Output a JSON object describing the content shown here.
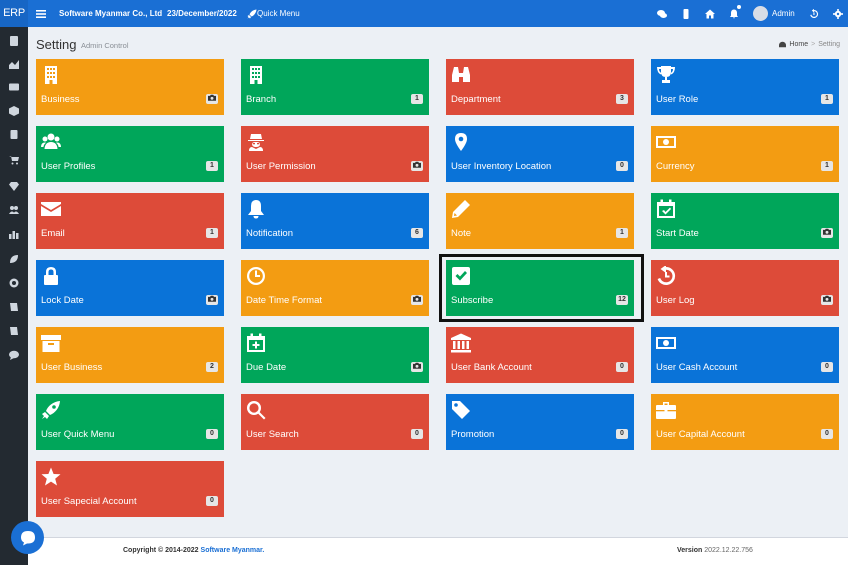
{
  "topbar": {
    "brand": "ERP",
    "company": "Software Myanmar Co., Ltd",
    "date": "23/December/2022",
    "quick_menu": "Quick Menu",
    "user": "Admin"
  },
  "page": {
    "title": "Setting",
    "subtitle": "Admin Control",
    "breadcrumb_home": "Home",
    "breadcrumb_sep": ">",
    "breadcrumb_current": "Setting"
  },
  "tiles": [
    {
      "label": "Business",
      "badge": "",
      "badge_icon": "camera-icon",
      "color": "#f39c12",
      "icon": "building-icon"
    },
    {
      "label": "Branch",
      "badge": "1",
      "color": "#00a65a",
      "icon": "building-icon"
    },
    {
      "label": "Department",
      "badge": "3",
      "color": "#dd4b39",
      "icon": "binoculars-icon"
    },
    {
      "label": "User Role",
      "badge": "1",
      "color": "#0a73d8",
      "icon": "trophy-icon"
    },
    {
      "label": "User Profiles",
      "badge": "1",
      "color": "#00a65a",
      "icon": "users-icon"
    },
    {
      "label": "User Permission",
      "badge": "",
      "badge_icon": "camera-icon",
      "color": "#dd4b39",
      "icon": "user-secret-icon"
    },
    {
      "label": "User Inventory Location",
      "badge": "0",
      "color": "#0a73d8",
      "icon": "map-marker-icon"
    },
    {
      "label": "Currency",
      "badge": "1",
      "color": "#f39c12",
      "icon": "money-icon"
    },
    {
      "label": "Email",
      "badge": "1",
      "color": "#dd4b39",
      "icon": "envelope-icon"
    },
    {
      "label": "Notification",
      "badge": "6",
      "color": "#0a73d8",
      "icon": "bell-icon"
    },
    {
      "label": "Note",
      "badge": "1",
      "color": "#f39c12",
      "icon": "pencil-icon"
    },
    {
      "label": "Start Date",
      "badge": "",
      "badge_icon": "camera-icon",
      "color": "#00a65a",
      "icon": "calendar-check-icon"
    },
    {
      "label": "Lock Date",
      "badge": "",
      "badge_icon": "camera-icon",
      "color": "#0a73d8",
      "icon": "lock-icon"
    },
    {
      "label": "Date Time Format",
      "badge": "",
      "badge_icon": "camera-icon",
      "color": "#f39c12",
      "icon": "clock-icon"
    },
    {
      "label": "Subscribe",
      "badge": "12",
      "color": "#00a65a",
      "icon": "check-square-icon"
    },
    {
      "label": "User Log",
      "badge": "",
      "badge_icon": "camera-icon",
      "color": "#dd4b39",
      "icon": "history-icon"
    },
    {
      "label": "User Business",
      "badge": "2",
      "color": "#f39c12",
      "icon": "archive-icon"
    },
    {
      "label": "Due Date",
      "badge": "",
      "badge_icon": "camera-icon",
      "color": "#00a65a",
      "icon": "calendar-plus-icon"
    },
    {
      "label": "User Bank Account",
      "badge": "0",
      "color": "#dd4b39",
      "icon": "bank-icon"
    },
    {
      "label": "User Cash Account",
      "badge": "0",
      "color": "#0a73d8",
      "icon": "money-icon"
    },
    {
      "label": "User Quick Menu",
      "badge": "0",
      "color": "#00a65a",
      "icon": "rocket-icon"
    },
    {
      "label": "User Search",
      "badge": "0",
      "color": "#dd4b39",
      "icon": "search-icon"
    },
    {
      "label": "Promotion",
      "badge": "0",
      "color": "#0a73d8",
      "icon": "tag-icon"
    },
    {
      "label": "User Capital Account",
      "badge": "0",
      "color": "#f39c12",
      "icon": "briefcase-icon"
    },
    {
      "label": "User Sapecial Account",
      "badge": "0",
      "color": "#dd4b39",
      "icon": "star-icon"
    }
  ],
  "footer": {
    "copyright": "Copyright © 2014-2022",
    "company_link": "Software Myanmar.",
    "version_label": "Version",
    "version": "2022.12.22.756"
  },
  "colors": {
    "topbar": "#1a6fd4",
    "sidebar": "#232a31",
    "orange": "#f39c12",
    "green": "#00a65a",
    "red": "#dd4b39",
    "blue": "#0a73d8"
  }
}
